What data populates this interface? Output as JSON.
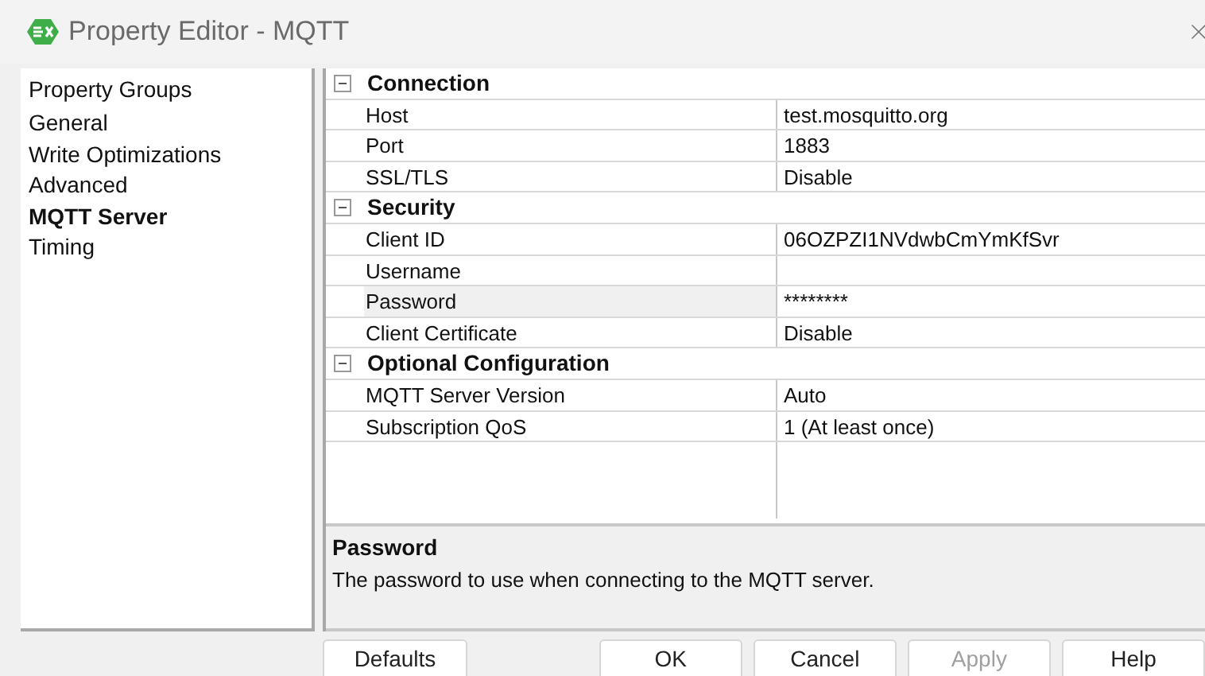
{
  "window": {
    "title": "Property Editor - MQTT"
  },
  "sidebar": {
    "heading": "Property Groups",
    "items": [
      {
        "label": "General",
        "selected": false
      },
      {
        "label": "Write Optimizations",
        "selected": false
      },
      {
        "label": "Advanced",
        "selected": false
      },
      {
        "label": "MQTT Server",
        "selected": true
      },
      {
        "label": "Timing",
        "selected": false
      }
    ]
  },
  "property_grid": {
    "categories": [
      {
        "name": "Connection",
        "expanded": true,
        "properties": [
          {
            "name": "Host",
            "value": "test.mosquitto.org",
            "selected": false
          },
          {
            "name": "Port",
            "value": "1883",
            "selected": false
          },
          {
            "name": "SSL/TLS",
            "value": "Disable",
            "selected": false
          }
        ]
      },
      {
        "name": "Security",
        "expanded": true,
        "properties": [
          {
            "name": "Client ID",
            "value": "06OZPZI1NVdwbCmYmKfSvr",
            "selected": false
          },
          {
            "name": "Username",
            "selected": false
          },
          {
            "name": "Password",
            "value": "********",
            "selected": true
          },
          {
            "name": "Client Certificate",
            "value": "Disable",
            "selected": false
          }
        ]
      },
      {
        "name": "Optional Configuration",
        "expanded": true,
        "properties": [
          {
            "name": "MQTT Server Version",
            "value": "Auto",
            "selected": false
          },
          {
            "name": "Subscription QoS",
            "value": "1 (At least once)",
            "selected": false
          }
        ]
      }
    ]
  },
  "description": {
    "title": "Password",
    "text": "The password to use when connecting to the MQTT server."
  },
  "buttons": [
    {
      "label": "Defaults",
      "disabled": false
    },
    {
      "label": "OK",
      "disabled": false
    },
    {
      "label": "Cancel",
      "disabled": false
    },
    {
      "label": "Apply",
      "disabled": true
    },
    {
      "label": "Help",
      "disabled": false
    }
  ]
}
